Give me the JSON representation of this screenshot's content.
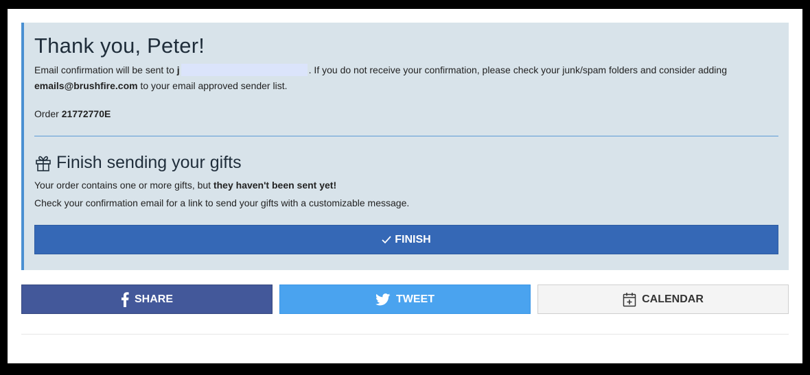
{
  "confirmation": {
    "title": "Thank you, Peter!",
    "email_prefix": "Email confirmation will be sent to",
    "email_initial": "j",
    "email_suffix": ". If you do not receive your confirmation, please check your junk/spam folders and consider adding",
    "sender_email": "emails@brushfire.com",
    "sender_suffix": "to your email approved sender list.",
    "order_label": "Order",
    "order_number": "21772770E"
  },
  "gifts": {
    "title": "Finish sending your gifts",
    "icon": "gift-icon",
    "line1_prefix": "Your order contains one or more gifts, but",
    "line1_bold": "they haven't been sent yet!",
    "line2": "Check your confirmation email for a link to send your gifts with a customizable message.",
    "finish_label": "FINISH"
  },
  "social": {
    "share_label": "SHARE",
    "tweet_label": "TWEET",
    "calendar_label": "CALENDAR"
  },
  "colors": {
    "panel_bg": "#d8e3ea",
    "accent_border": "#4a90d2",
    "finish_bg": "#3568b6",
    "facebook": "#43589a",
    "twitter": "#4aa3ef",
    "calendar_bg": "#f4f4f4"
  }
}
